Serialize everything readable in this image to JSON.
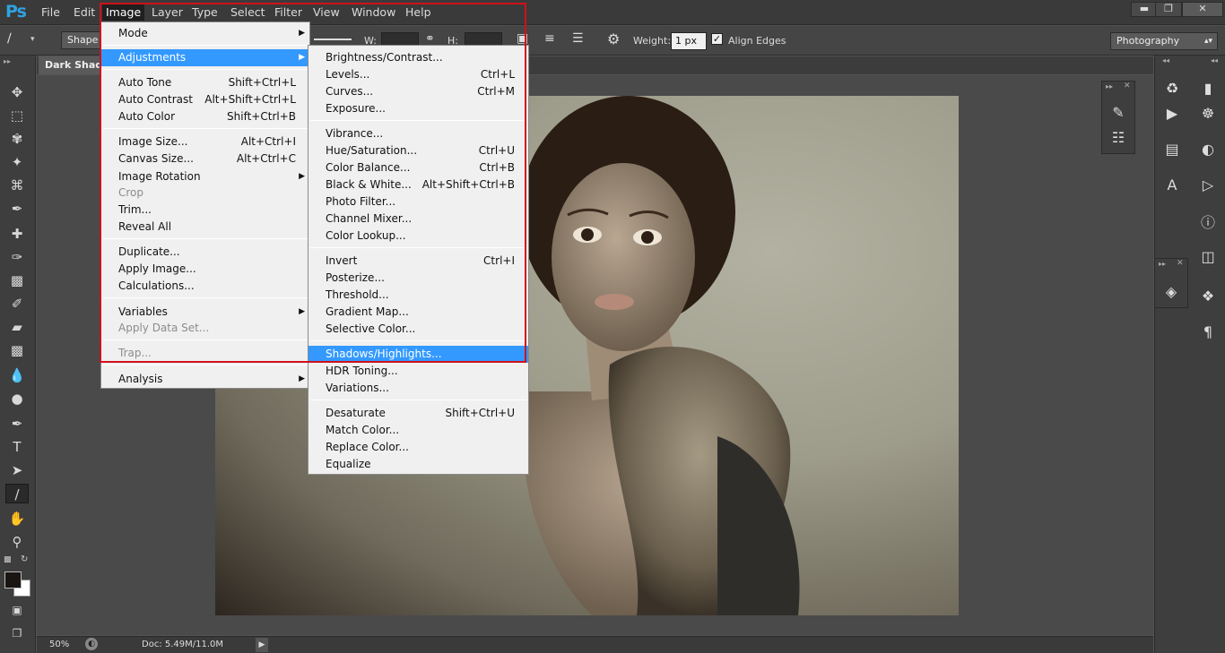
{
  "app": {
    "logo": "Ps",
    "menu": [
      "File",
      "Edit",
      "Image",
      "Layer",
      "Type",
      "Select",
      "Filter",
      "View",
      "Window",
      "Help"
    ],
    "window_controls": [
      "minimize-icon",
      "restore-icon",
      "close-icon"
    ]
  },
  "options": {
    "shape_label": "Shape",
    "w_label": "W:",
    "h_label": "H:",
    "weight_label": "Weight:",
    "weight_value": "1 px",
    "align_edges_label": "Align Edges",
    "align_edges_checked": true,
    "workspace": "Photography"
  },
  "document": {
    "tab_title": "Dark Shadows"
  },
  "status": {
    "zoom": "50%",
    "doc_info": "Doc: 5.49M/11.0M"
  },
  "image_menu": {
    "mode": "Mode",
    "adjustments": "Adjustments",
    "auto_tone": {
      "label": "Auto Tone",
      "shortcut": "Shift+Ctrl+L"
    },
    "auto_contrast": {
      "label": "Auto Contrast",
      "shortcut": "Alt+Shift+Ctrl+L"
    },
    "auto_color": {
      "label": "Auto Color",
      "shortcut": "Shift+Ctrl+B"
    },
    "image_size": {
      "label": "Image Size...",
      "shortcut": "Alt+Ctrl+I"
    },
    "canvas_size": {
      "label": "Canvas Size...",
      "shortcut": "Alt+Ctrl+C"
    },
    "image_rotation": "Image Rotation",
    "crop": "Crop",
    "trim": "Trim...",
    "reveal_all": "Reveal All",
    "duplicate": "Duplicate...",
    "apply_image": "Apply Image...",
    "calculations": "Calculations...",
    "variables": "Variables",
    "apply_data_set": "Apply Data Set...",
    "trap": "Trap...",
    "analysis": "Analysis"
  },
  "adjustments_menu": {
    "brightness_contrast": {
      "label": "Brightness/Contrast...",
      "shortcut": ""
    },
    "levels": {
      "label": "Levels...",
      "shortcut": "Ctrl+L"
    },
    "curves": {
      "label": "Curves...",
      "shortcut": "Ctrl+M"
    },
    "exposure": {
      "label": "Exposure...",
      "shortcut": ""
    },
    "vibrance": {
      "label": "Vibrance...",
      "shortcut": ""
    },
    "hue_saturation": {
      "label": "Hue/Saturation...",
      "shortcut": "Ctrl+U"
    },
    "color_balance": {
      "label": "Color Balance...",
      "shortcut": "Ctrl+B"
    },
    "black_white": {
      "label": "Black & White...",
      "shortcut": "Alt+Shift+Ctrl+B"
    },
    "photo_filter": {
      "label": "Photo Filter...",
      "shortcut": ""
    },
    "channel_mixer": {
      "label": "Channel Mixer...",
      "shortcut": ""
    },
    "color_lookup": {
      "label": "Color Lookup...",
      "shortcut": ""
    },
    "invert": {
      "label": "Invert",
      "shortcut": "Ctrl+I"
    },
    "posterize": {
      "label": "Posterize...",
      "shortcut": ""
    },
    "threshold": {
      "label": "Threshold...",
      "shortcut": ""
    },
    "gradient_map": {
      "label": "Gradient Map...",
      "shortcut": ""
    },
    "selective_color": {
      "label": "Selective Color...",
      "shortcut": ""
    },
    "shadows_highlights": {
      "label": "Shadows/Highlights...",
      "shortcut": ""
    },
    "hdr_toning": {
      "label": "HDR Toning...",
      "shortcut": ""
    },
    "variations": {
      "label": "Variations...",
      "shortcut": ""
    },
    "desaturate": {
      "label": "Desaturate",
      "shortcut": "Shift+Ctrl+U"
    },
    "match_color": {
      "label": "Match Color...",
      "shortcut": ""
    },
    "replace_color": {
      "label": "Replace Color...",
      "shortcut": ""
    },
    "equalize": {
      "label": "Equalize",
      "shortcut": ""
    }
  },
  "colors": {
    "highlight": "#3399ff",
    "annotation_box": "#d0101a",
    "ps_blue": "#2fa3e0"
  }
}
